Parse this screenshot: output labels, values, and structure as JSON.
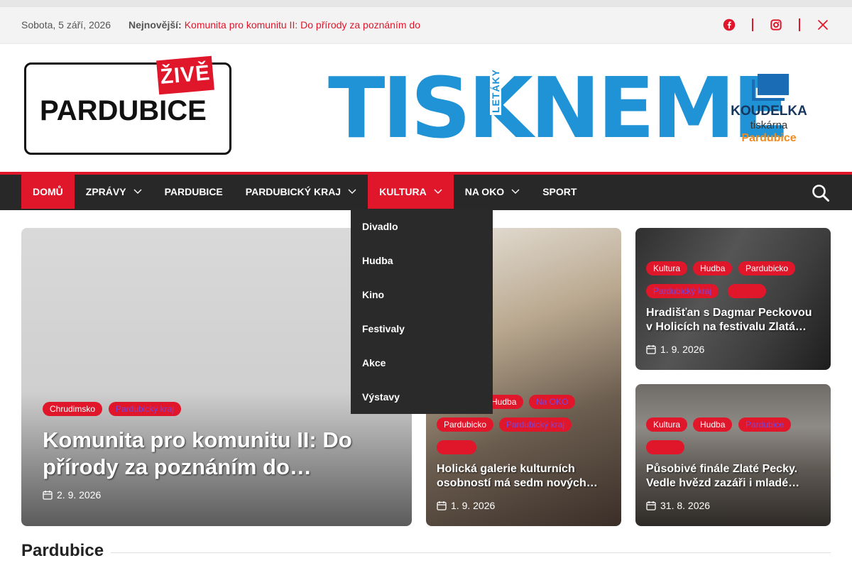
{
  "topbar": {
    "date": "Sobota, 5 září, 2026",
    "latest_label": "Nejnovější:",
    "latest_text": "Komunita pro komunitu II: Do přírody za poznáním do"
  },
  "social": [
    "facebook-icon",
    "instagram-icon",
    "x-icon"
  ],
  "logo": {
    "live": "ŽIVĚ",
    "city": "PARDUBICE"
  },
  "banner": {
    "main": "TISKNEME",
    "vertical": "LETÁKY",
    "brand": "KOUDELKA",
    "brand_sub": "tiskárna",
    "brand_town": "Pardubice"
  },
  "nav": {
    "items": [
      {
        "label": "Domů",
        "active": true,
        "has_dropdown": false
      },
      {
        "label": "Zprávy",
        "active": false,
        "has_dropdown": true
      },
      {
        "label": "Pardubice",
        "active": false,
        "has_dropdown": false
      },
      {
        "label": "Pardubický kraj",
        "active": false,
        "has_dropdown": true
      },
      {
        "label": "Kultura",
        "active": true,
        "has_dropdown": true
      },
      {
        "label": "Na oko",
        "active": false,
        "has_dropdown": true
      },
      {
        "label": "Sport",
        "active": false,
        "has_dropdown": false
      }
    ],
    "dropdown": [
      "Divadlo",
      "Hudba",
      "Kino",
      "Festivaly",
      "Akce",
      "Výstavy"
    ]
  },
  "cards": [
    {
      "tags": [
        "Chrudimsko",
        "Pardubický kraj"
      ],
      "title": "Komunita pro komunitu II: Do přírody za poznáním do…",
      "date": "2. 9. 2026"
    },
    {
      "tags": [
        "Hudba",
        "Na OKO",
        "Pardubicko",
        "Pardubický kraj"
      ],
      "title": "Holická galerie kulturních osobností má sedm nových…",
      "date": "1. 9. 2026"
    },
    {
      "tags": [
        "Kultura",
        "Hudba",
        "Pardubicko",
        "Pardubický kraj"
      ],
      "title": "Hradišťan s Dagmar Peckovou v Holicích na festivalu Zlatá…",
      "date": "1. 9. 2026"
    },
    {
      "tags": [
        "Kultura",
        "Hudba",
        "Pardubice"
      ],
      "title": "Působivé finále Zlaté Pecky. Vedle hvězd zazáři i mladé…",
      "date": "31. 8. 2026"
    }
  ],
  "section": {
    "title": "Pardubice"
  },
  "colors": {
    "accent": "#e0162b",
    "nav_bg": "#282828",
    "banner_blue": "#1f93d6"
  }
}
